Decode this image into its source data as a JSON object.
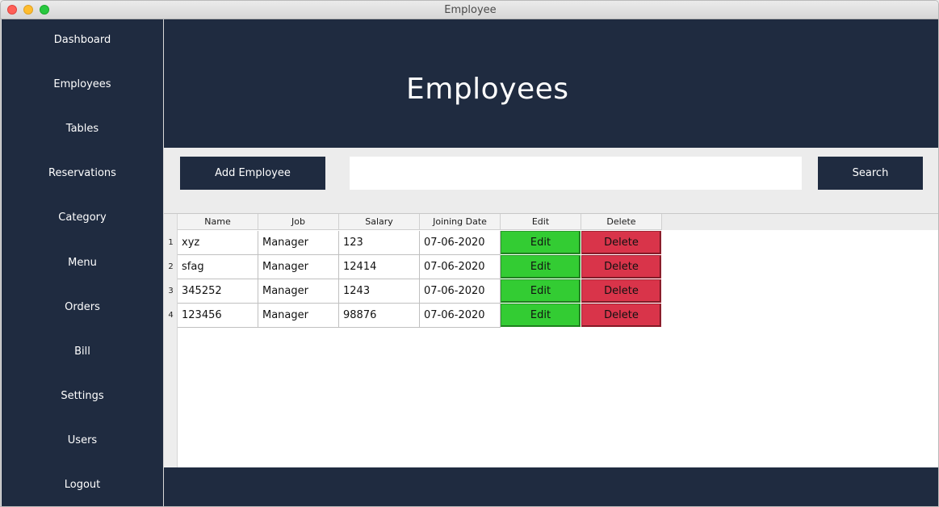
{
  "window": {
    "title": "Employee"
  },
  "sidebar": {
    "items": [
      {
        "label": "Dashboard"
      },
      {
        "label": "Employees"
      },
      {
        "label": "Tables"
      },
      {
        "label": "Reservations"
      },
      {
        "label": "Category"
      },
      {
        "label": "Menu"
      },
      {
        "label": "Orders"
      },
      {
        "label": "Bill"
      },
      {
        "label": "Settings"
      },
      {
        "label": "Users"
      },
      {
        "label": "Logout"
      }
    ]
  },
  "header": {
    "title": "Employees"
  },
  "toolbar": {
    "add_label": "Add Employee",
    "search_value": "",
    "search_label": "Search"
  },
  "table": {
    "columns": [
      "Name",
      "Job",
      "Salary",
      "Joining Date",
      "Edit",
      "Delete"
    ],
    "rows": [
      {
        "num": "1",
        "name": "xyz",
        "job": "Manager",
        "salary": "123",
        "date": "07-06-2020",
        "edit": "Edit",
        "delete": "Delete"
      },
      {
        "num": "2",
        "name": "sfag",
        "job": "Manager",
        "salary": "12414",
        "date": "07-06-2020",
        "edit": "Edit",
        "delete": "Delete"
      },
      {
        "num": "3",
        "name": "345252",
        "job": "Manager",
        "salary": "1243",
        "date": "07-06-2020",
        "edit": "Edit",
        "delete": "Delete"
      },
      {
        "num": "4",
        "name": "123456",
        "job": "Manager",
        "salary": "98876",
        "date": "07-06-2020",
        "edit": "Edit",
        "delete": "Delete"
      }
    ]
  },
  "colors": {
    "navy": "#1f2b40",
    "edit_green": "#33cc33",
    "delete_red": "#d9344a"
  }
}
